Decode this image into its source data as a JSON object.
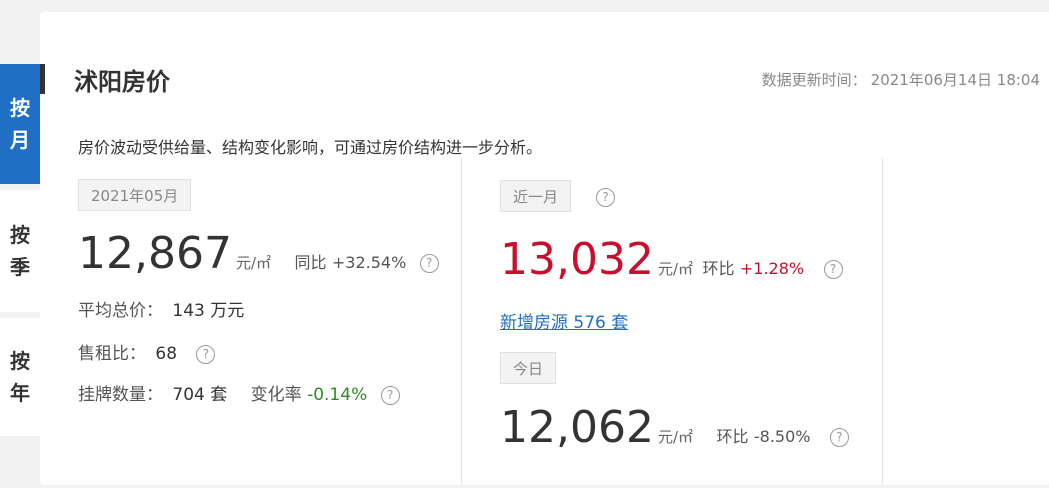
{
  "side_tabs": [
    {
      "label_1": "按",
      "label_2": "月"
    },
    {
      "label_1": "按",
      "label_2": "季"
    },
    {
      "label_1": "按",
      "label_2": "年"
    }
  ],
  "header": {
    "title": "沭阳房价",
    "update_label": "数据更新时间：",
    "update_time": "2021年06月14日 18:04"
  },
  "description": "房价波动受供给量、结构变化影响，可通过房价结构进一步分析。",
  "monthly": {
    "period": "2021年05月",
    "price": "12,867",
    "unit": "元/㎡",
    "yoy_label": "同比",
    "yoy_value": "+32.54%",
    "avg_total_label": "平均总价：",
    "avg_total_value": "143",
    "avg_total_unit": "万元",
    "rent_ratio_label": "售租比：",
    "rent_ratio_value": "68",
    "listing_label": "挂牌数量：",
    "listing_value": "704",
    "listing_unit": "套",
    "change_label": "变化率",
    "change_value": "-0.14%"
  },
  "recent_month": {
    "tag": "近一月",
    "price": "13,032",
    "unit": "元/㎡",
    "mom_label": "环比",
    "mom_value": "+1.28%",
    "new_listing_link": "新增房源 576 套"
  },
  "today": {
    "tag": "今日",
    "price": "12,062",
    "unit": "元/㎡",
    "mom_label": "环比",
    "mom_value": "-8.50%"
  },
  "help_icon": "?",
  "colors": {
    "accent": "#1f6fc5",
    "up": "#c8102e",
    "down": "#2f8a25"
  }
}
